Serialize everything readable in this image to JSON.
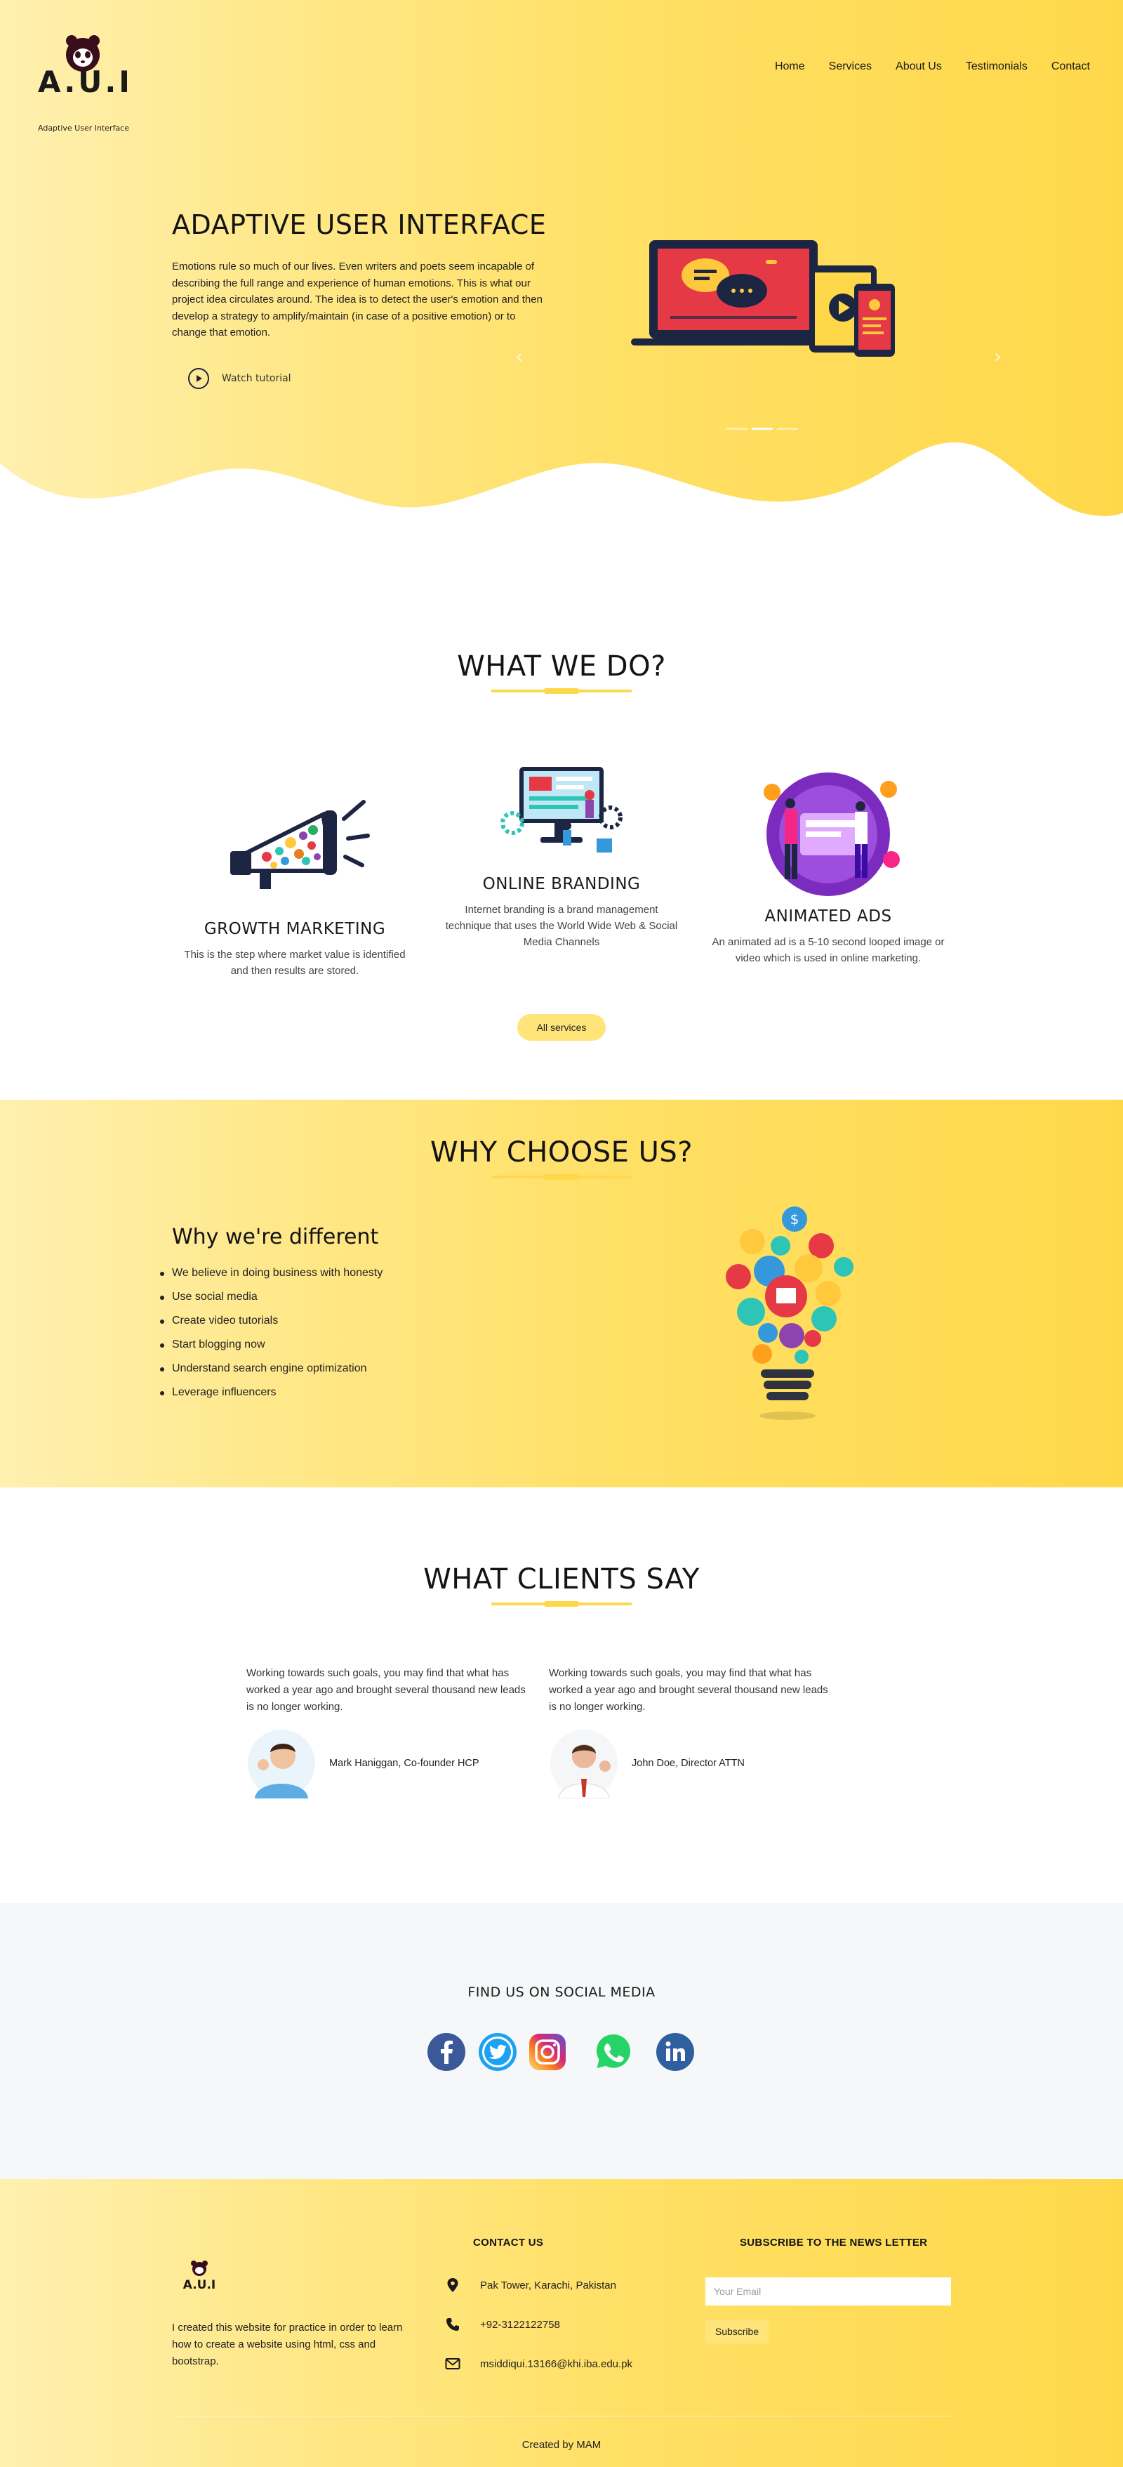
{
  "brand": {
    "logo_letters": "A.U.I",
    "tagline": "Adaptive User Interface"
  },
  "nav": [
    {
      "label": "Home"
    },
    {
      "label": "Services"
    },
    {
      "label": "About Us"
    },
    {
      "label": "Testimonials"
    },
    {
      "label": "Contact"
    }
  ],
  "hero": {
    "title": "ADAPTIVE USER INTERFACE",
    "text": "Emotions rule so much of our lives. Even writers and poets seem incapable of describing the full range and experience of human emotions. This is what our project idea circulates around. The idea is to detect the user's emotion and then develop a strategy to amplify/maintain (in case of a positive emotion) or to change that emotion.",
    "watch_label": "Watch tutorial",
    "carousel_slides": 3,
    "active_slide": 2
  },
  "what_we_do": {
    "title": "WHAT WE DO?",
    "services": [
      {
        "title": "GROWTH MARKETING",
        "text": "This is the step where market value is identified and then results are stored.",
        "icon": "megaphone-icon"
      },
      {
        "title": "ONLINE BRANDING",
        "text": "Internet branding is a brand management technique that uses the World Wide Web & Social Media Channels",
        "icon": "branding-illustration"
      },
      {
        "title": "ANIMATED ADS",
        "text": "An animated ad is a 5-10 second looped image or video which is used in online marketing.",
        "icon": "animated-ads-illustration"
      }
    ],
    "button_label": "All services"
  },
  "why_choose": {
    "title": "WHY CHOOSE US?",
    "subtitle": "Why we're different",
    "points": [
      "We believe in doing business with honesty",
      "Use social media",
      "Create video tutorials",
      "Start blogging now",
      "Understand search engine optimization",
      "Leverage influencers"
    ]
  },
  "clients": {
    "title": "WHAT CLIENTS SAY",
    "testimonials": [
      {
        "text": "Working towards such goals, you may find that what has worked a year ago and brought several thousand new leads is no longer working.",
        "name": "Mark Haniggan, Co-founder HCP"
      },
      {
        "text": "Working towards such goals, you may find that what has worked a year ago and brought several thousand new leads is no longer working.",
        "name": "John Doe, Director ATTN"
      }
    ]
  },
  "social": {
    "title": "FIND US ON SOCIAL MEDIA",
    "networks": [
      {
        "name": "facebook-icon",
        "color": "#3b5998"
      },
      {
        "name": "twitter-icon",
        "color": "#1da1f2"
      },
      {
        "name": "instagram-icon",
        "color": "#c13584"
      },
      {
        "name": "whatsapp-icon",
        "color": "#25d366"
      },
      {
        "name": "linkedin-icon",
        "color": "#2e5f9e"
      }
    ]
  },
  "footer": {
    "about": "I created this website for practice in order to learn how to create a website using html, css and bootstrap.",
    "contact_title": "CONTACT US",
    "address": "Pak Tower, Karachi, Pakistan",
    "phone": "+92-3122122758",
    "email": "msiddiqui.13166@khi.iba.edu.pk",
    "newsletter_title": "SUBSCRIBE TO THE NEWS LETTER",
    "email_placeholder": "Your Email",
    "subscribe_label": "Subscribe",
    "credit": "Created by MAM"
  },
  "colors": {
    "accent": "#ffd84a",
    "button": "#ffe47a",
    "text": "#1f1f1f"
  }
}
